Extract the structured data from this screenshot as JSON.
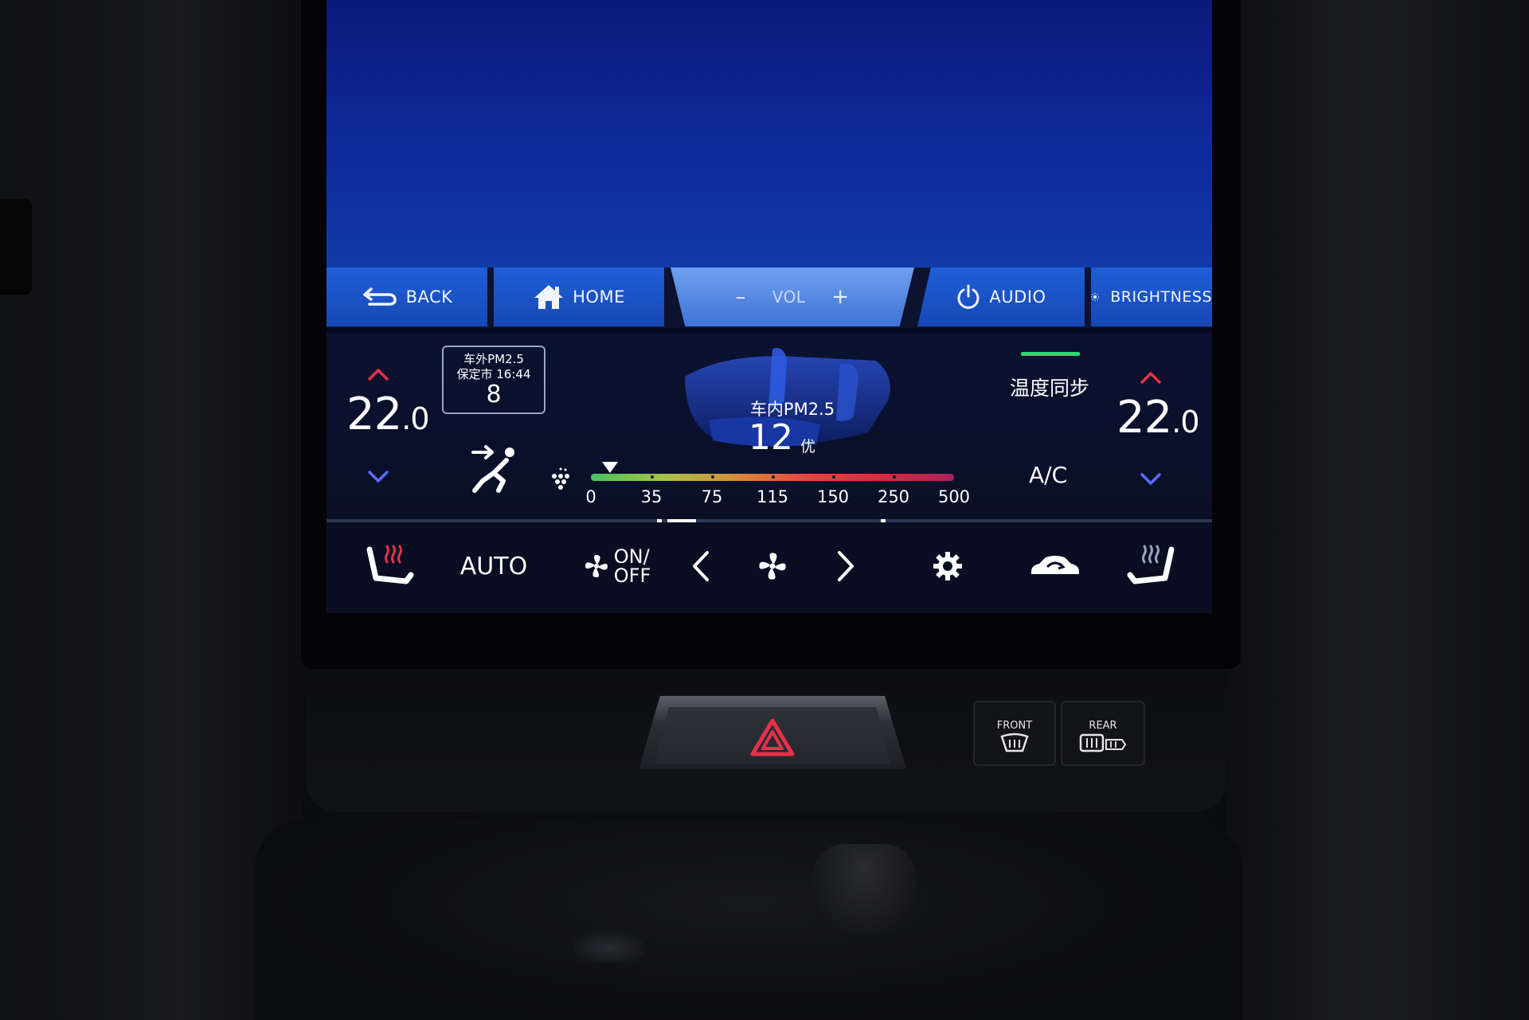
{
  "navbar": {
    "back_label": "BACK",
    "home_label": "HOME",
    "vol_label": "VOL",
    "vol_minus": "–",
    "vol_plus": "+",
    "audio_label": "AUDIO",
    "brightness_label": "BRIGHTNESS"
  },
  "climate": {
    "left_temp_int": "22",
    "left_temp_dec": ".0",
    "right_temp_int": "22",
    "right_temp_dec": ".0",
    "outside_pm": {
      "line1": "车外PM2.5",
      "line2": "保定市 16:44",
      "value": "8"
    },
    "inside_pm": {
      "label": "车内PM2.5",
      "value": "12",
      "grade": "优"
    },
    "sync_label": "温度同步",
    "ac_label": "A/C",
    "scale_ticks": [
      "0",
      "35",
      "75",
      "115",
      "150",
      "250",
      "500"
    ]
  },
  "controls": {
    "auto_label": "AUTO",
    "on_label": "ON/",
    "off_label": "OFF"
  },
  "console": {
    "front_label": "FRONT",
    "rear_label": "REAR"
  },
  "colors": {
    "nav_blue": "#1f5fd8",
    "up_arrow": "#e8314a",
    "down_arrow": "#5a6cff",
    "sync_bar": "#2dd873",
    "hazard": "#e8314a"
  }
}
